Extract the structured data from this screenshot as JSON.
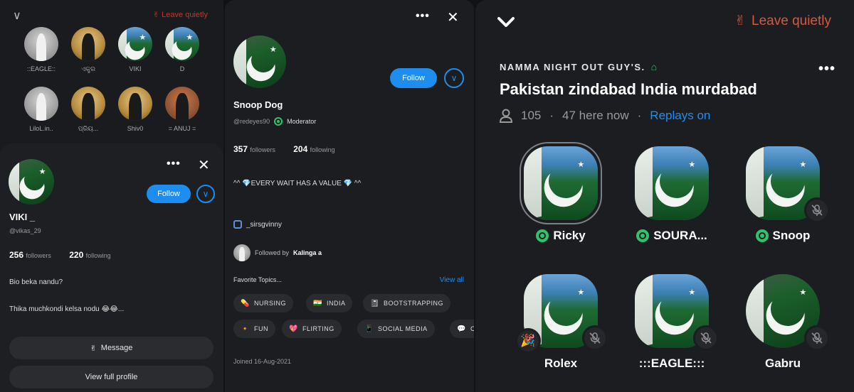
{
  "left_panel": {
    "leave_label": "Leave quietly",
    "mini_speakers": [
      {
        "name": "::EAGLE::",
        "style": "gray"
      },
      {
        "name": "ଏକ୍ଟ୍ର",
        "style": "sil"
      },
      {
        "name": "VIKI",
        "style": "flag"
      },
      {
        "name": "D",
        "style": "flag"
      },
      {
        "name": "LiloL.in..",
        "style": "gray"
      },
      {
        "name": "ପ୍ରିୟ...",
        "style": "sil"
      },
      {
        "name": "Shiv0",
        "style": "sil"
      },
      {
        "name": "= ANUJ =",
        "style": "red"
      }
    ],
    "card": {
      "name": "VIKI _",
      "handle": "@vikas_29",
      "followers_count": "256",
      "followers_label": "followers",
      "following_count": "220",
      "following_label": "following",
      "follow_label": "Follow",
      "bio_line1": "Bio beka nandu?",
      "bio_line2": "Thika muchkondi kelsa nodu 😂😂...",
      "message_label": "Message",
      "view_profile_label": "View full profile"
    }
  },
  "middle_panel": {
    "name": "Snoop Dog",
    "handle": "@redeyes90",
    "role": "Moderator",
    "follow_label": "Follow",
    "followers_count": "357",
    "followers_label": "followers",
    "following_count": "204",
    "following_label": "following",
    "bio": "^^ 💎EVERY  WAIT HAS  A VALUE 💎 ^^",
    "link_label": "_sirsgvinny",
    "followed_by_prefix": "Followed by",
    "followed_by_name": "Kalinga a",
    "topics_label": "Favorite Topics...",
    "view_all_label": "View all",
    "topics_row1": [
      {
        "emoji": "💊",
        "label": "NURSING"
      },
      {
        "emoji": "🇮🇳",
        "label": "INDIA"
      },
      {
        "emoji": "📓",
        "label": "BOOTSTRAPPING"
      }
    ],
    "topics_row2": [
      {
        "emoji": "🔸",
        "label": "FUN"
      },
      {
        "emoji": "💖",
        "label": "FLIRTING"
      },
      {
        "emoji": "📱",
        "label": "SOCIAL MEDIA"
      },
      {
        "emoji": "💬",
        "label": "C"
      }
    ],
    "joined": "Joined 16-Aug-2021"
  },
  "room": {
    "leave_label": "Leave quietly",
    "club_name": "NAMMA NIGHT OUT GUY'S.",
    "title": "Pakistan zindabad India murdabad",
    "listener_count": "105",
    "here_now": "47 here now",
    "replays": "Replays on",
    "speakers": [
      {
        "name": "Ricky",
        "moderator": true,
        "muted": false,
        "ring": true,
        "shape": "rounded"
      },
      {
        "name": "SOURA...",
        "moderator": true,
        "muted": false,
        "ring": false,
        "shape": "rounded"
      },
      {
        "name": "Snoop",
        "moderator": true,
        "muted": true,
        "ring": false,
        "shape": "rounded"
      },
      {
        "name": "Rolex",
        "moderator": false,
        "muted": true,
        "ring": false,
        "shape": "rounded",
        "emoji": "🎉"
      },
      {
        "name": ":::EAGLE:::",
        "moderator": false,
        "muted": true,
        "ring": false,
        "shape": "rounded"
      },
      {
        "name": "Gabru",
        "moderator": false,
        "muted": true,
        "ring": false,
        "shape": "circle"
      }
    ]
  },
  "colors": {
    "accent_blue": "#1d8ef0",
    "moderator_green": "#2fc36b",
    "leave_red": "#d35a3f",
    "background": "#1c1d20"
  },
  "icons": {
    "chevron": "chevron-down-icon",
    "leave": "peace-hand-icon",
    "more": "more-dots-icon",
    "close": "close-icon",
    "house": "house-icon",
    "person": "person-icon",
    "mute": "mic-muted-icon",
    "moderator": "moderator-badge-icon"
  }
}
